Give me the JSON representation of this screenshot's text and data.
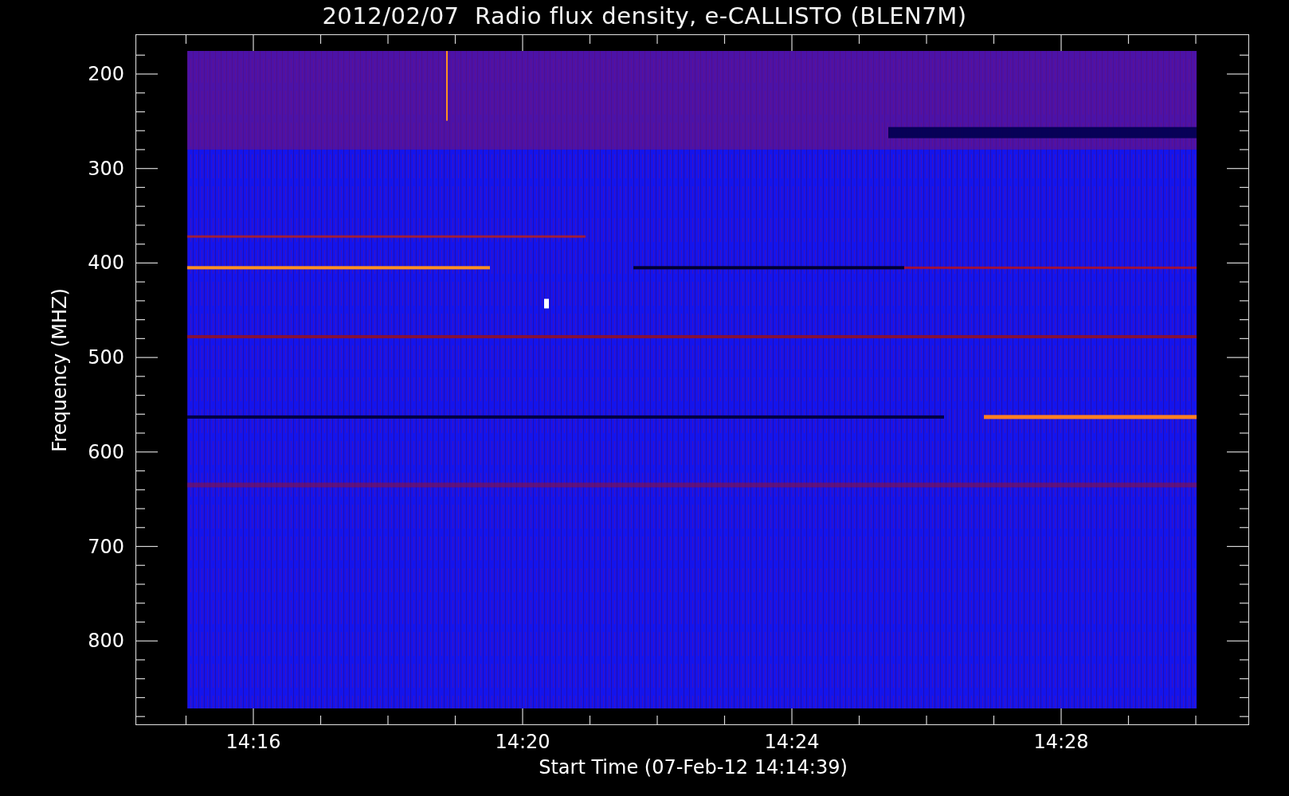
{
  "title": "2012/02/07  Radio flux density, e-CALLISTO (BLEN7M)",
  "plot": {
    "ylabel": "Frequency (MHZ)",
    "xlabel": "Start Time (07-Feb-12 14:14:39)",
    "yticks": [
      "200",
      "300",
      "400",
      "500",
      "600",
      "700",
      "800"
    ],
    "xticks": [
      "14:16",
      "14:20",
      "14:24",
      "14:28"
    ]
  }
}
